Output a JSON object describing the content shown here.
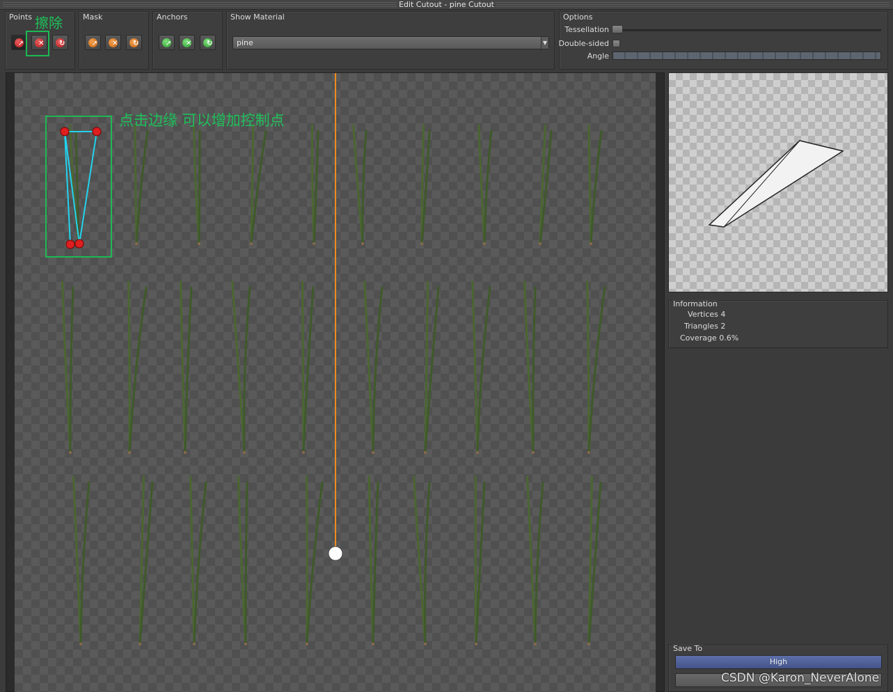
{
  "window": {
    "title": "Edit Cutout - pine Cutout"
  },
  "toolbar": {
    "points": {
      "label": "Points",
      "buttons": [
        "add-point",
        "erase-point",
        "reset-point"
      ]
    },
    "mask": {
      "label": "Mask",
      "buttons": [
        "mask-add",
        "mask-erase",
        "mask-reset"
      ]
    },
    "anchors": {
      "label": "Anchors",
      "buttons": [
        "anchor-add",
        "anchor-erase",
        "anchor-reset"
      ]
    },
    "show_material": {
      "label": "Show Material",
      "value": "pine"
    },
    "options": {
      "label": "Options",
      "tessellation_label": "Tessellation",
      "tessellation_value": 0,
      "double_sided_label": "Double-sided",
      "double_sided_checked": false,
      "angle_label": "Angle"
    }
  },
  "annotations": {
    "erase": "擦除",
    "edge_hint": "点击边缘 可以增加控制点",
    "highlight_color": "#1db954"
  },
  "canvas": {
    "guide_color": "#f08a1c",
    "outline_color": "#22d3ee",
    "point_color": "#dd1f1f"
  },
  "info": {
    "title": "Information",
    "vertices": "Vertices 4",
    "triangles": "Triangles 2",
    "coverage": "Coverage 0.6%"
  },
  "save": {
    "title": "Save To",
    "high_label": "High",
    "medium_label": ""
  },
  "watermark": "CSDN @Karon_NeverAlone",
  "icons": [
    "cursor-icon",
    "x-icon",
    "refresh-icon"
  ]
}
